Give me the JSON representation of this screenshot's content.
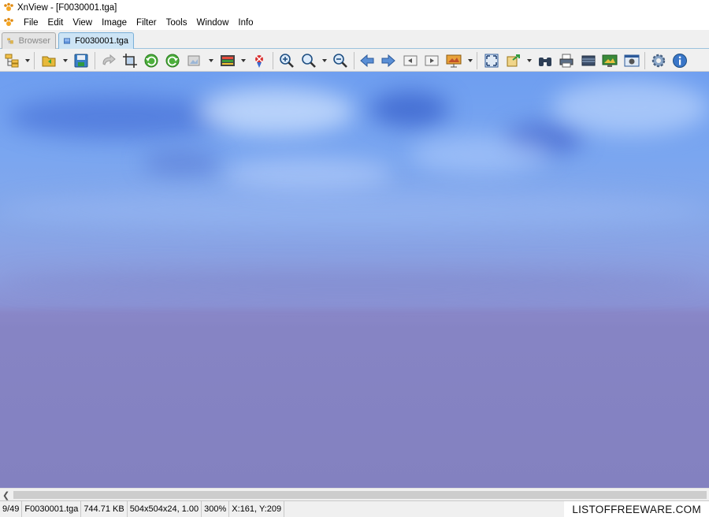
{
  "window": {
    "title": "XnView - [F0030001.tga]"
  },
  "menu": {
    "items": [
      "File",
      "Edit",
      "View",
      "Image",
      "Filter",
      "Tools",
      "Window",
      "Info"
    ]
  },
  "tabs": [
    {
      "label": "Browser",
      "active": false
    },
    {
      "label": "F0030001.tga",
      "active": true
    }
  ],
  "toolbar": {
    "icons": [
      "browser-icon",
      "open-folder-icon",
      "save-icon",
      "undo-icon",
      "crop-icon",
      "rotate-left-icon",
      "rotate-right-icon",
      "image-tools-icon",
      "adjust-colors-icon",
      "red-eye-icon",
      "zoom-in-icon",
      "zoom-icon",
      "zoom-out-icon",
      "previous-icon",
      "next-icon",
      "first-icon",
      "last-icon",
      "slideshow-icon",
      "fullscreen-icon",
      "export-icon",
      "find-icon",
      "print-icon",
      "scanner-icon",
      "wallpaper-icon",
      "capture-icon",
      "settings-icon",
      "info-icon"
    ]
  },
  "status": {
    "index": "9/49",
    "filename": "F0030001.tga",
    "filesize": "744.71 KB",
    "dimensions": "504x504x24, 1.00",
    "zoom": "300%",
    "coords": "X:161, Y:209"
  },
  "watermark": "LISTOFFREEWARE.COM",
  "colors": {
    "sky_top": "#6e9ef0",
    "sea": "#8381c0",
    "tab_active": "#cde4f5"
  }
}
